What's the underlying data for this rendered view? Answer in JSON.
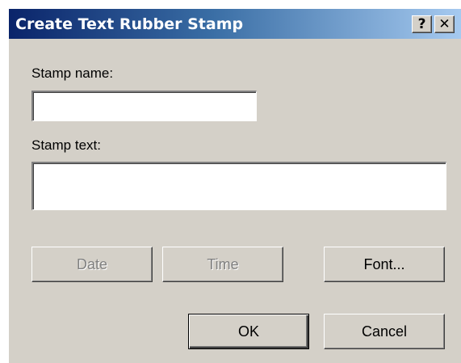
{
  "window": {
    "title": "Create Text Rubber Stamp",
    "help_label": "?",
    "close_label": "✕"
  },
  "form": {
    "name_label": "Stamp name:",
    "name_value": "",
    "text_label": "Stamp text:",
    "text_value": ""
  },
  "buttons": {
    "date": "Date",
    "time": "Time",
    "font": "Font...",
    "ok": "OK",
    "cancel": "Cancel"
  },
  "colors": {
    "titlebar_start": "#0a246a",
    "titlebar_end": "#a6caf0",
    "dialog_face": "#d4d0c8"
  },
  "icons": {
    "help": "help-icon",
    "close": "close-icon"
  }
}
